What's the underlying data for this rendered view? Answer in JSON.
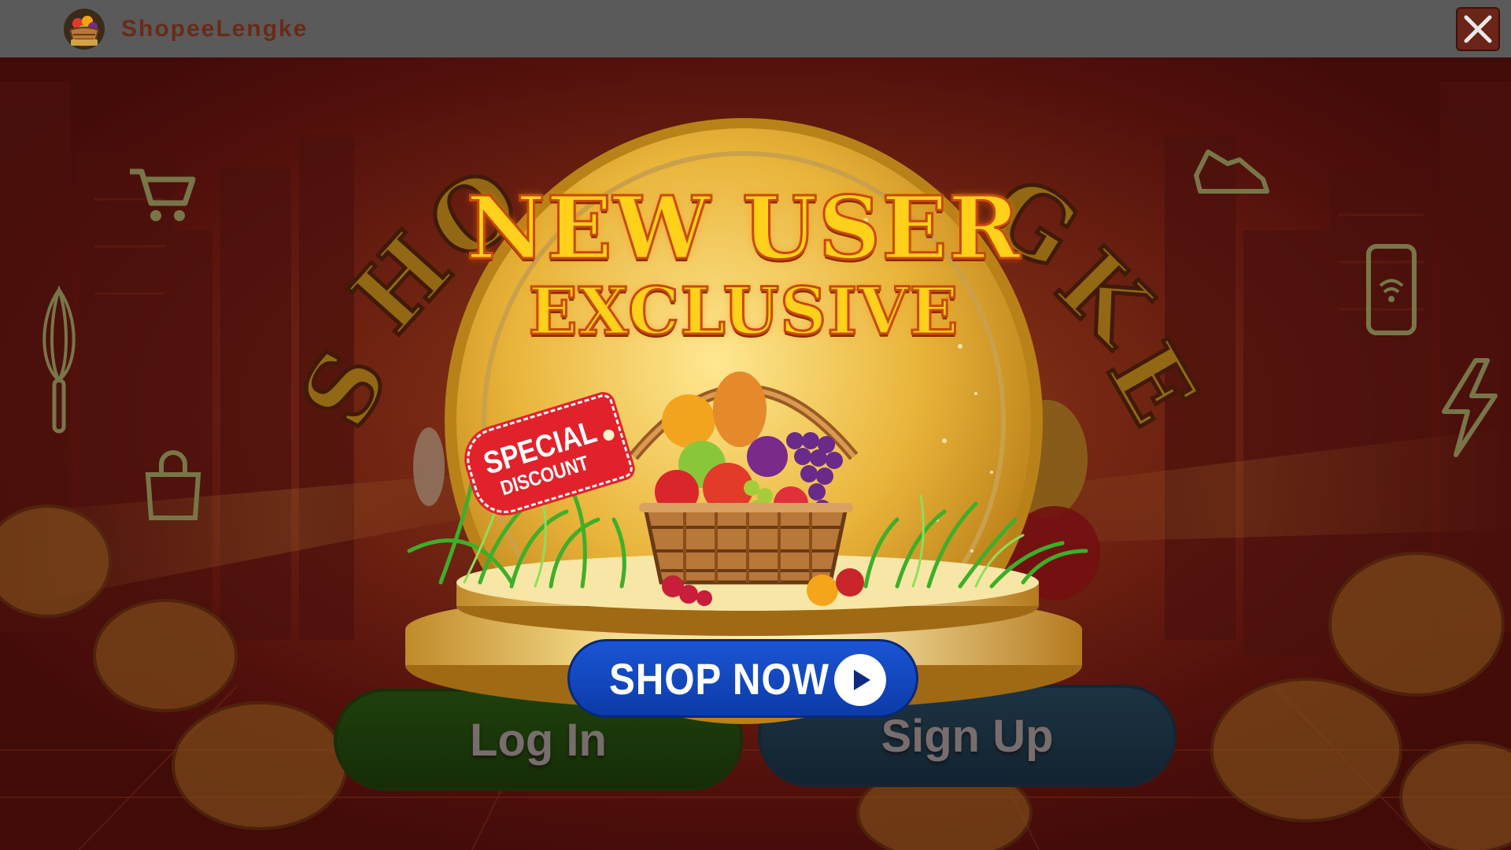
{
  "header": {
    "app_title": "ShopeeLengke",
    "logo_icon": "fruit-basket-icon",
    "close_icon": "close-icon"
  },
  "background": {
    "arc_title": "SHOPEELENGKE",
    "neon_icons": [
      "shopping-cart-icon",
      "whisk-icon",
      "shopping-bag-icon",
      "sneaker-icon",
      "smartphone-icon",
      "lightning-icon"
    ],
    "login_label": "Log In",
    "signup_label": "Sign Up"
  },
  "promo": {
    "headline_line1": "NEW USER",
    "headline_line2": "EXCLUSIVE",
    "tag_line1": "SPECIAL",
    "tag_line2": "DISCOUNT",
    "shop_button_label": "SHOP NOW",
    "shop_button_icon": "play-icon",
    "illustration": "fruit-basket-icon"
  },
  "colors": {
    "header_bg": "#5a5a5a",
    "title_color": "#6a2a18",
    "close_bg": "#6b2418",
    "headline_fill": "#ffd11a",
    "headline_stroke": "#c84a0a",
    "shop_button": "#1a55d4",
    "tag_red": "#e2222b",
    "login_green": "#1f6b13",
    "signup_teal": "#1c5570"
  }
}
